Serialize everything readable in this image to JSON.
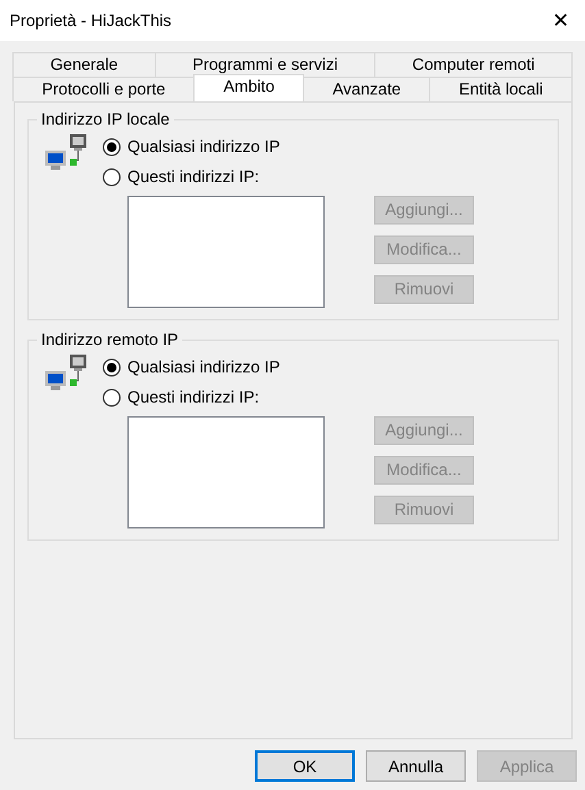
{
  "window": {
    "title": "Proprietà - HiJackThis",
    "close": "✕"
  },
  "tab_rows": [
    [
      {
        "label": "Generale",
        "selected": false
      },
      {
        "label": "Programmi e servizi",
        "selected": false
      },
      {
        "label": "Computer remoti",
        "selected": false
      }
    ],
    [
      {
        "label": "Protocolli e porte",
        "selected": false
      },
      {
        "label": "Ambito",
        "selected": true
      },
      {
        "label": "Avanzate",
        "selected": false
      },
      {
        "label": "Entità locali",
        "selected": false
      }
    ]
  ],
  "groups": [
    {
      "title": "Indirizzo IP locale",
      "options": [
        {
          "label": "Qualsiasi indirizzo IP",
          "selected": true
        },
        {
          "label": "Questi indirizzi IP:",
          "selected": false
        }
      ],
      "buttons": [
        {
          "label": "Aggiungi...",
          "disabled": true
        },
        {
          "label": "Modifica...",
          "disabled": true
        },
        {
          "label": "Rimuovi",
          "disabled": true
        }
      ]
    },
    {
      "title": "Indirizzo remoto IP",
      "options": [
        {
          "label": "Qualsiasi indirizzo IP",
          "selected": true
        },
        {
          "label": "Questi indirizzi IP:",
          "selected": false
        }
      ],
      "buttons": [
        {
          "label": "Aggiungi...",
          "disabled": true
        },
        {
          "label": "Modifica...",
          "disabled": true
        },
        {
          "label": "Rimuovi",
          "disabled": true
        }
      ]
    }
  ],
  "footer_buttons": [
    {
      "label": "OK",
      "default": true,
      "disabled": false
    },
    {
      "label": "Annulla",
      "default": false,
      "disabled": false
    },
    {
      "label": "Applica",
      "default": false,
      "disabled": true
    }
  ]
}
